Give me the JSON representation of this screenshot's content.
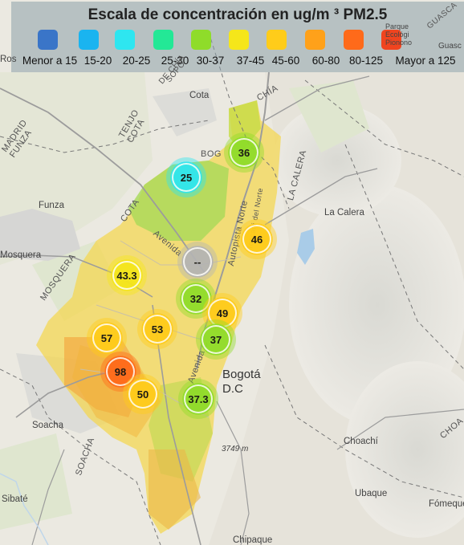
{
  "legend": {
    "title": "Escala de concentración en ug/m ³ PM2.5",
    "items": [
      {
        "label": "Menor a 15",
        "color": "#3a75c8"
      },
      {
        "label": "15-20",
        "color": "#1ab4f0"
      },
      {
        "label": "20-25",
        "color": "#2ee6f0"
      },
      {
        "label": "25-30",
        "color": "#23e896"
      },
      {
        "label": "30-37",
        "color": "#8fdc2a"
      },
      {
        "label": "37-45",
        "color": "#f5e61a"
      },
      {
        "label": "45-60",
        "color": "#ffcc1a"
      },
      {
        "label": "60-80",
        "color": "#ffa11a"
      },
      {
        "label": "80-125",
        "color": "#ff6a1a"
      },
      {
        "label": "Mayor a 125",
        "color": "#f0441f"
      }
    ]
  },
  "stations": [
    {
      "value": "36",
      "color": "#8fdc2a"
    },
    {
      "value": "25",
      "color": "#2ee6f0"
    },
    {
      "value": "46",
      "color": "#ffcc1a"
    },
    {
      "value": "--",
      "color": "#b4b4b4"
    },
    {
      "value": "43.3",
      "color": "#f5e61a"
    },
    {
      "value": "32",
      "color": "#8fdc2a"
    },
    {
      "value": "49",
      "color": "#ffcc1a"
    },
    {
      "value": "57",
      "color": "#ffcc1a"
    },
    {
      "value": "53",
      "color": "#ffcc1a"
    },
    {
      "value": "37",
      "color": "#8fdc2a"
    },
    {
      "value": "98",
      "color": "#ff6a1a"
    },
    {
      "value": "50",
      "color": "#ffcc1a"
    },
    {
      "value": "37.3",
      "color": "#8fdc2a"
    }
  ],
  "places": {
    "cota": "Cota",
    "funza": "Funza",
    "mosquera": "Mosquera",
    "la_calera": "La Calera",
    "bogota": "Bogotá\nD.C",
    "soacha": "Soacha",
    "choachi": "Choachí",
    "sibate": "Sibaté",
    "ubaque": "Ubaque",
    "fomeque": "Fómeque",
    "chipaque": "Chipaque",
    "parque": "Parque\nEcológi\nPionono",
    "guasca": "Guasc",
    "rosa": "Ros",
    "elevation": "3749 m"
  },
  "roads": {
    "madrid_funza": "MADRID\nFUNZA",
    "tenjo_cota": "TENJO\nCOTA",
    "mosquera_road": "MOSQUERA",
    "chia": "CHÍA",
    "la_calera_road": "LA CALERA",
    "avenida_boyaca": "Avenida",
    "autopista_norte": "Autopista Norte",
    "toscani": "Toscani del Norte",
    "avenida_c": "Avenida C",
    "soacha_road": "SOACHA",
    "choachi_road": "CHOA",
    "bog": "BOG",
    "sopo": "SOPÓ",
    "cota_road": "COTA",
    "de_chia": "DE CHÍA",
    "guasca_road": "GUASCA"
  }
}
